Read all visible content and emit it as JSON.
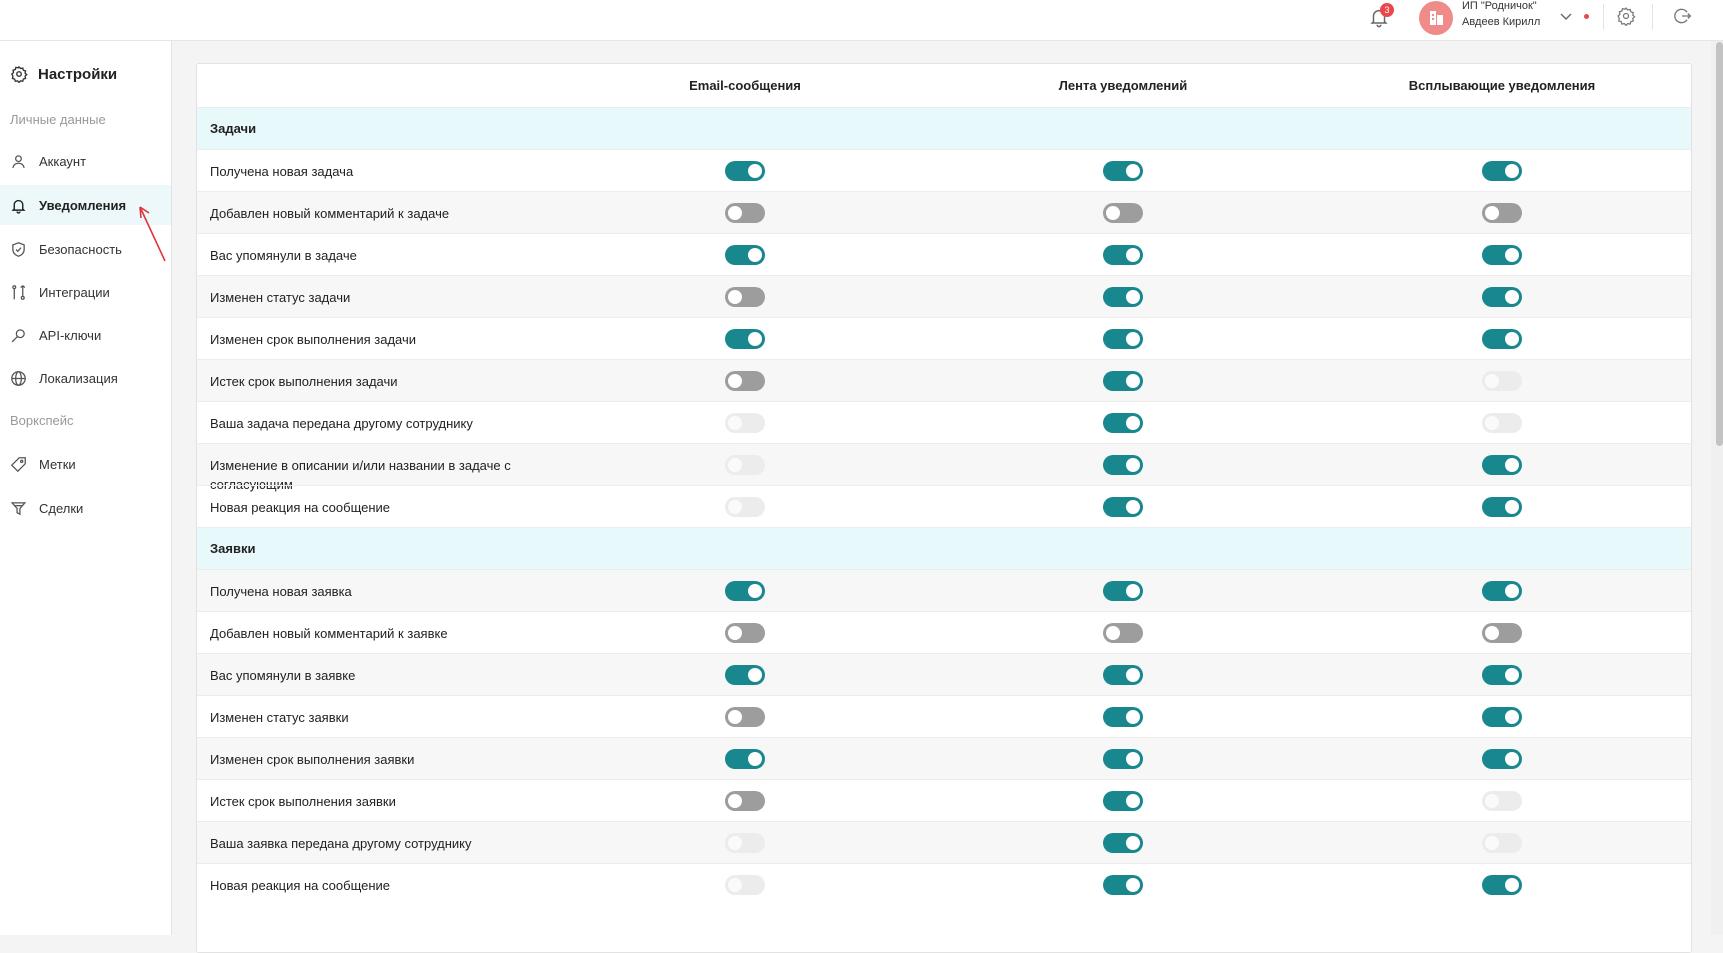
{
  "header": {
    "notifications_count": "3",
    "org_name": "ИП \"Родничок\"",
    "user_name": "Авдеев Кирилл",
    "icons": [
      "bell-icon",
      "chevron-down-icon",
      "gear-icon",
      "logout-icon"
    ]
  },
  "sidebar": {
    "title": "Настройки",
    "section_personal": "Личные данные",
    "section_workspace": "Воркспейс",
    "items": [
      {
        "label": "Аккаунт",
        "icon": "user-icon"
      },
      {
        "label": "Уведомления",
        "icon": "bell-icon",
        "active": true
      },
      {
        "label": "Безопасность",
        "icon": "shield-icon"
      },
      {
        "label": "Интеграции",
        "icon": "integration-icon"
      },
      {
        "label": "API-ключи",
        "icon": "key-icon"
      },
      {
        "label": "Локализация",
        "icon": "globe-icon"
      },
      {
        "label": "Метки",
        "icon": "tag-icon"
      },
      {
        "label": "Сделки",
        "icon": "funnel-icon"
      }
    ]
  },
  "table": {
    "columns": [
      "Email-сообщения",
      "Лента уведомлений",
      "Всплывающие уведомления"
    ],
    "sections": [
      {
        "title": "Задачи",
        "rows": [
          {
            "label": "Получена новая задача",
            "states": [
              "on",
              "on",
              "on"
            ]
          },
          {
            "label": "Добавлен новый комментарий к задаче",
            "states": [
              "off",
              "off",
              "off"
            ]
          },
          {
            "label": "Вас упомянули в задаче",
            "states": [
              "on",
              "on",
              "on"
            ]
          },
          {
            "label": "Изменен статус задачи",
            "states": [
              "off",
              "on",
              "on"
            ]
          },
          {
            "label": "Изменен срок выполнения задачи",
            "states": [
              "on",
              "on",
              "on"
            ]
          },
          {
            "label": "Истек срок выполнения задачи",
            "states": [
              "off",
              "on",
              "disabled"
            ]
          },
          {
            "label": "Ваша задача передана другому сотруднику",
            "states": [
              "disabled",
              "on",
              "disabled"
            ]
          },
          {
            "label": "Изменение в описании и/или названии в задаче с согласующим",
            "states": [
              "disabled",
              "on",
              "on"
            ]
          },
          {
            "label": "Новая реакция на сообщение",
            "states": [
              "disabled",
              "on",
              "on"
            ]
          }
        ]
      },
      {
        "title": "Заявки",
        "rows": [
          {
            "label": "Получена новая заявка",
            "states": [
              "on",
              "on",
              "on"
            ]
          },
          {
            "label": "Добавлен новый комментарий к заявке",
            "states": [
              "off",
              "off",
              "off"
            ]
          },
          {
            "label": "Вас упомянули в заявке",
            "states": [
              "on",
              "on",
              "on"
            ]
          },
          {
            "label": "Изменен статус заявки",
            "states": [
              "off",
              "on",
              "on"
            ]
          },
          {
            "label": "Изменен срок выполнения заявки",
            "states": [
              "on",
              "on",
              "on"
            ]
          },
          {
            "label": "Истек срок выполнения заявки",
            "states": [
              "off",
              "on",
              "disabled"
            ]
          },
          {
            "label": "Ваша заявка передана другому сотруднику",
            "states": [
              "disabled",
              "on",
              "disabled"
            ]
          },
          {
            "label": "Новая реакция на сообщение",
            "states": [
              "disabled",
              "on",
              "on"
            ]
          }
        ]
      }
    ]
  },
  "colors": {
    "accent": "#19888e",
    "section_bg": "#e8f9fb",
    "active_item_bg": "#edf8fa",
    "badge": "#e8474b",
    "avatar": "#ef8b89",
    "annotation_arrow": "#e0353b"
  }
}
